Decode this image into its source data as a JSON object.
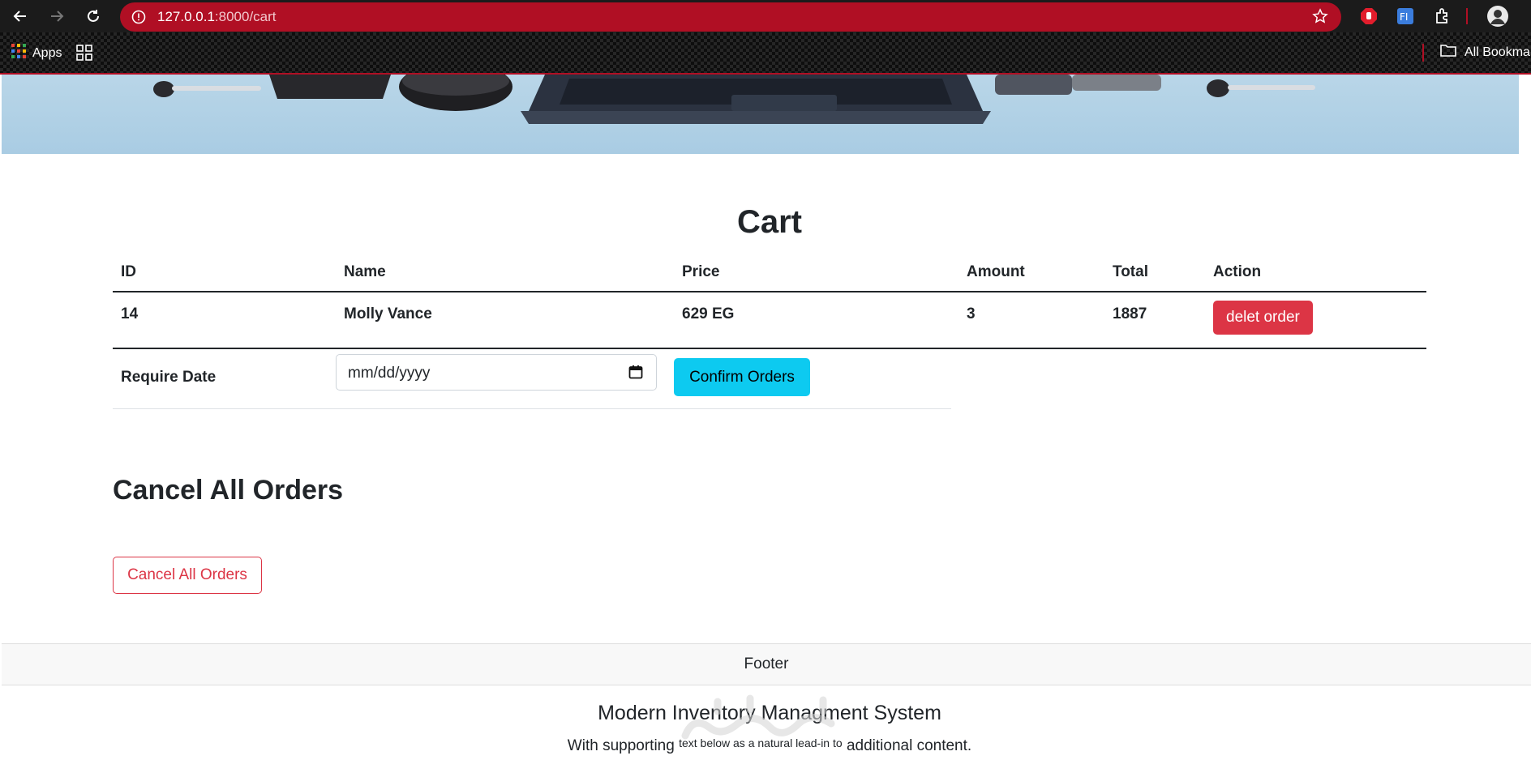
{
  "browser": {
    "url_host": "127.0.0.1",
    "url_path": ":8000/cart",
    "bookmarks": {
      "apps_label": "Apps",
      "all_bookmarks_label": "All Bookmar"
    }
  },
  "cart": {
    "title": "Cart",
    "columns": [
      "ID",
      "Name",
      "Price",
      "Amount",
      "Total",
      "Action"
    ],
    "rows": [
      {
        "id": "14",
        "name": "Molly Vance",
        "price": "629 EG",
        "amount": "3",
        "total": "1887",
        "action_label": "delet order"
      }
    ],
    "require_date_label": "Require Date",
    "date_placeholder": "mm/dd/yyyy",
    "confirm_label": "Confirm Orders"
  },
  "cancel": {
    "title": "Cancel All Orders",
    "button_label": "Cancel All Orders"
  },
  "footer": {
    "bar_label": "Footer",
    "title": "Modern Inventory Managment System",
    "text_start": "With supporting",
    "text_middle": "text below as a natural lead-in to",
    "text_end": "additional content."
  },
  "colors": {
    "omnibox": "#b00f24",
    "danger": "#dc3545",
    "info": "#0dcaf0",
    "hero_bg": "#a9cce3"
  }
}
